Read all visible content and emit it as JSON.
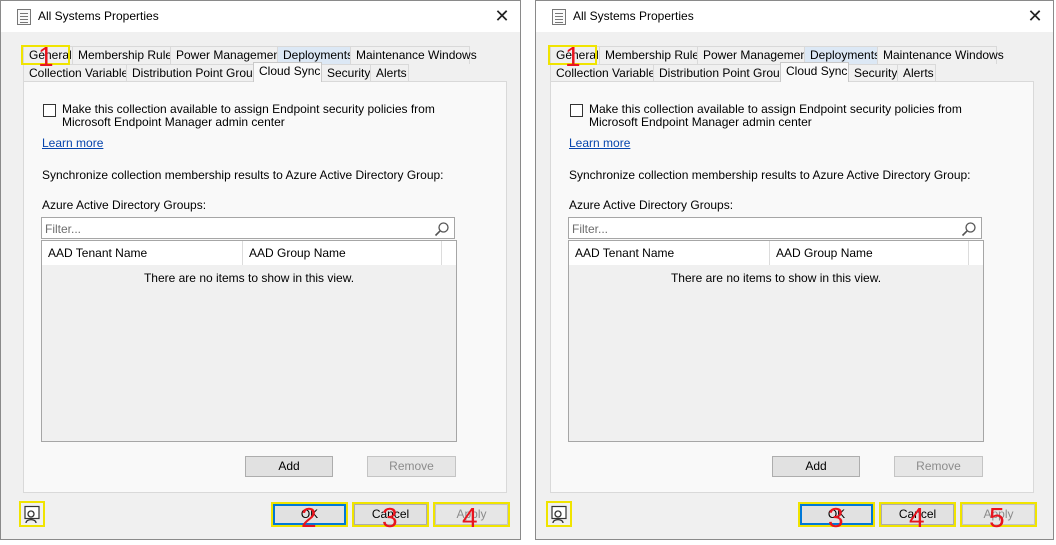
{
  "dialogs": [
    {
      "title": "All Systems Properties",
      "close_glyph": "✕",
      "tabs_row1": [
        "General",
        "Membership Rules",
        "Power Management",
        "Deployments",
        "Maintenance Windows"
      ],
      "tabs_row2": [
        "Collection Variables",
        "Distribution Point Groups",
        "Cloud Sync",
        "Security",
        "Alerts"
      ],
      "active_tab": "Cloud Sync",
      "checkbox_label": "Make this collection available to assign Endpoint security policies from Microsoft Endpoint Manager admin center",
      "checkbox_checked": false,
      "learn_more": "Learn more",
      "sync_label": "Synchronize collection membership results to Azure Active Directory Group:",
      "groups_label": "Azure Active Directory Groups:",
      "filter_placeholder": "Filter...",
      "columns": [
        "AAD Tenant Name",
        "AAD Group Name"
      ],
      "empty_message": "There are no items to show in this view.",
      "add_label": "Add",
      "remove_label": "Remove",
      "ok_label": "OK",
      "cancel_label": "Cancel",
      "apply_label": "Apply",
      "annotations": [
        "1",
        "2",
        "3",
        "4"
      ]
    },
    {
      "title": "All Systems Properties",
      "close_glyph": "✕",
      "tabs_row1": [
        "General",
        "Membership Rules",
        "Power Management",
        "Deployments",
        "Maintenance Windows"
      ],
      "tabs_row2": [
        "Collection Variables",
        "Distribution Point Groups",
        "Cloud Sync",
        "Security",
        "Alerts"
      ],
      "active_tab": "Cloud Sync",
      "checkbox_label": "Make this collection available to assign Endpoint security policies from Microsoft Endpoint Manager admin center",
      "checkbox_checked": false,
      "learn_more": "Learn more",
      "sync_label": "Synchronize collection membership results to Azure Active Directory Group:",
      "groups_label": "Azure Active Directory Groups:",
      "filter_placeholder": "Filter...",
      "columns": [
        "AAD Tenant Name",
        "AAD Group Name"
      ],
      "empty_message": "There are no items to show in this view.",
      "add_label": "Add",
      "remove_label": "Remove",
      "ok_label": "OK",
      "cancel_label": "Cancel",
      "apply_label": "Apply",
      "annotations": [
        "1",
        "3",
        "4",
        "5"
      ]
    }
  ],
  "colors": {
    "highlight": "#f0e400",
    "annotation_number": "#e8141e",
    "link": "#0645ad",
    "default_button_border": "#0078d7",
    "blue_tab": "#dce8f5"
  },
  "icons": {
    "title": "properties-sheet-icon",
    "close": "close-icon",
    "search": "search-icon",
    "user": "user-icon"
  }
}
